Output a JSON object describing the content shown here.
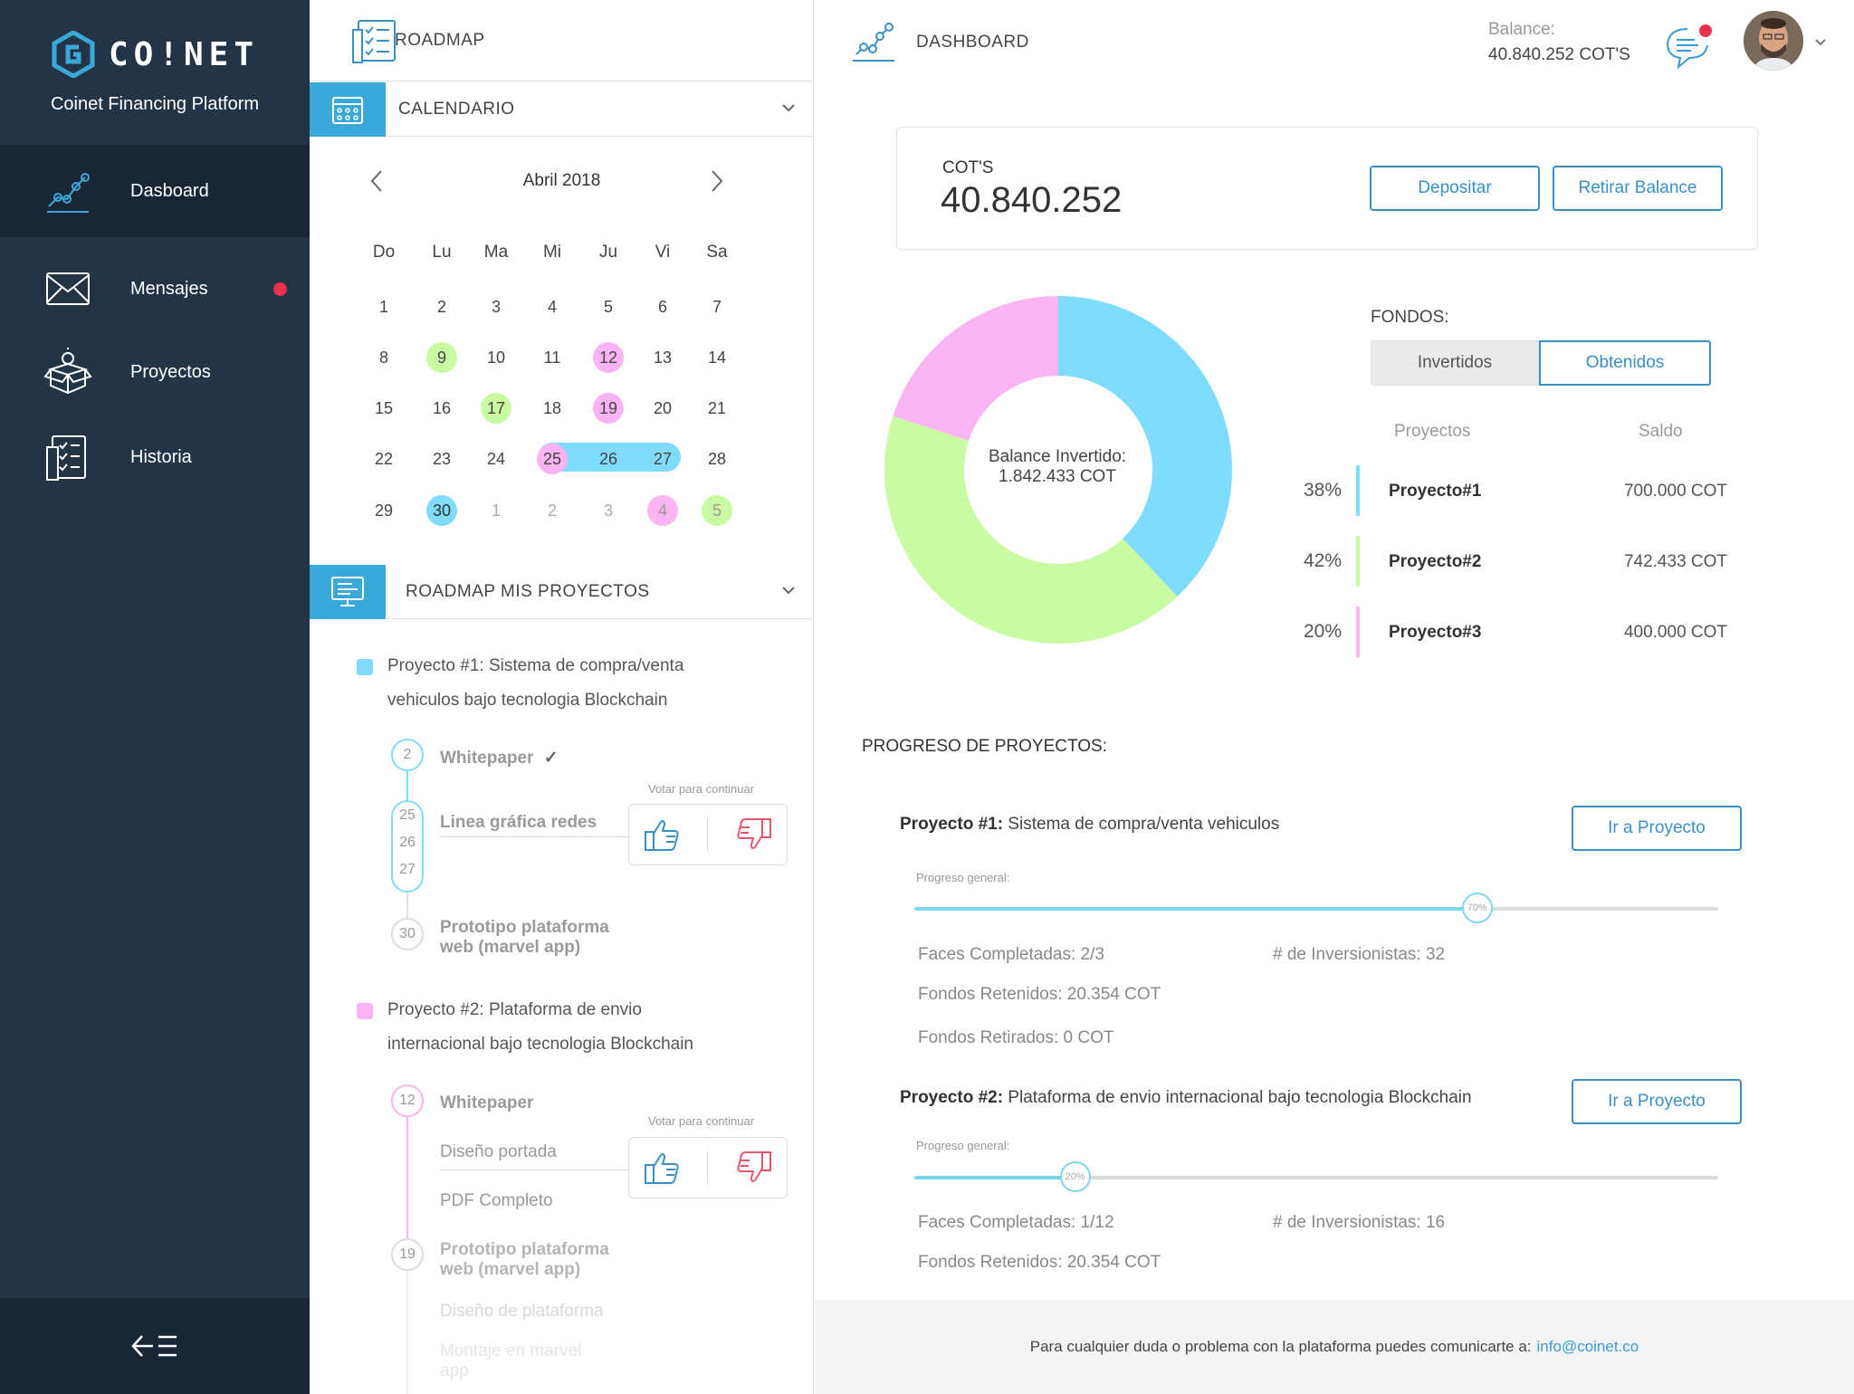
{
  "brand": {
    "name": "CO!NET",
    "subtitle": "Coinet Financing Platform"
  },
  "sidebar": {
    "items": [
      {
        "label": "Dasboard",
        "icon": "chart-steps-icon",
        "active": true
      },
      {
        "label": "Mensajes",
        "icon": "envelope-icon",
        "badge": true
      },
      {
        "label": "Proyectos",
        "icon": "box-bulb-icon"
      },
      {
        "label": "Historia",
        "icon": "checklist-icon"
      }
    ],
    "collapse_icon": "collapse-menu-icon"
  },
  "roadmap": {
    "title": "ROADMAP",
    "calendar_title": "CALENDARIO",
    "month": "Abril 2018",
    "weekdays": [
      "Do",
      "Lu",
      "Ma",
      "Mi",
      "Ju",
      "Vi",
      "Sa"
    ],
    "weeks": [
      [
        "1",
        "2",
        "3",
        "4",
        "5",
        "6",
        "7"
      ],
      [
        "8",
        "9",
        "10",
        "11",
        "12",
        "13",
        "14"
      ],
      [
        "15",
        "16",
        "17",
        "18",
        "19",
        "20",
        "21"
      ],
      [
        "22",
        "23",
        "24",
        "25",
        "26",
        "27",
        "28"
      ],
      [
        "29",
        "30",
        "1",
        "2",
        "3",
        "4",
        "5"
      ]
    ],
    "highlights": {
      "green": [
        "9",
        "17"
      ],
      "pink": [
        "12",
        "19",
        "25"
      ],
      "blue_today": [
        "30"
      ],
      "next_month_pink": [
        "4"
      ],
      "next_month_green": [
        "5"
      ],
      "range": [
        "25",
        "26",
        "27"
      ]
    },
    "projects_title": "ROADMAP MIS PROYECTOS",
    "vote_caption": "Votar para continuar",
    "projects": [
      {
        "title_line1": "Proyecto #1: Sistema de compra/venta",
        "title_line2": "vehiculos bajo tecnologia Blockchain",
        "color": "#7dd6ef",
        "steps": [
          {
            "day": "2",
            "label": "Whitepaper",
            "check": "✓"
          },
          {
            "days": [
              "25",
              "26",
              "27"
            ],
            "label": "Linea gráfica redes"
          },
          {
            "day": "30",
            "label_line1": "Prototipo plataforma",
            "label_line2": "web (marvel app)"
          }
        ]
      },
      {
        "title_line1": "Proyecto #2: Plataforma de envio",
        "title_line2": "internacional bajo tecnologia Blockchain",
        "color": "#f7a8f0",
        "steps": [
          {
            "day": "12",
            "label": "Whitepaper"
          },
          {
            "label": "Diseño portada"
          },
          {
            "label": "PDF Completo"
          },
          {
            "day": "19",
            "label_line1": "Prototipo plataforma",
            "label_line2": "web (marvel app)"
          },
          {
            "label": "Diseño de plataforma"
          },
          {
            "label_line1": "Montaje en marvel",
            "label_line2": "app"
          }
        ]
      }
    ]
  },
  "header": {
    "title": "DASHBOARD",
    "balance_label": "Balance:",
    "balance_value": "40.840.252  COT'S"
  },
  "balance_card": {
    "label": "COT'S",
    "value": "40.840.252",
    "deposit_label": "Depositar",
    "withdraw_label": "Retirar Balance"
  },
  "chart_data": {
    "type": "pie",
    "donut": true,
    "center_label_line1": "Balance Invertido:",
    "center_label_line2": "1.842.433 COT",
    "series": [
      {
        "name": "Proyecto#1",
        "value": 38,
        "color": "#7fdcfd"
      },
      {
        "name": "Proyecto#2",
        "value": 42,
        "color": "#c9fba3"
      },
      {
        "name": "Proyecto#3",
        "value": 20,
        "color": "#fbb4f3"
      }
    ]
  },
  "funds": {
    "label": "FONDOS:",
    "toggle_invested": "Invertidos",
    "toggle_obtained": "Obtenidos",
    "col_projects": "Proyectos",
    "col_balance": "Saldo",
    "rows": [
      {
        "pct": "38%",
        "name": "Proyecto#1",
        "saldo": "700.000 COT",
        "color": "#7fdcfd"
      },
      {
        "pct": "42%",
        "name": "Proyecto#2",
        "saldo": "742.433 COT",
        "color": "#c9fba3"
      },
      {
        "pct": "20%",
        "name": "Proyecto#3",
        "saldo": "400.000 COT",
        "color": "#fbb4f3"
      }
    ]
  },
  "progress": {
    "title": "PROGRESO DE PROYECTOS:",
    "caption": "Progreso general:",
    "go_label": "Ir a Proyecto",
    "projects": [
      {
        "name_bold": "Proyecto #1:",
        "name_rest": " Sistema de compra/venta vehiculos",
        "progress": 70,
        "progress_label": "70%",
        "phases": "Faces Completadas: 2/3",
        "investors": "# de Inversionistas: 32",
        "retained": "Fondos Retenidos: 20.354 COT",
        "withdrawn": "Fondos Retirados: 0 COT"
      },
      {
        "name_bold": "Proyecto #2:",
        "name_rest": " Plataforma de envio internacional bajo tecnologia Blockchain",
        "progress": 20,
        "progress_label": "20%",
        "phases": "Faces Completadas: 1/12",
        "investors": "# de Inversionistas: 16",
        "retained": "Fondos Retenidos: 20.354 COT"
      }
    ]
  },
  "footer": {
    "text": "Para cualquier duda o problema con la plataforma puedes comunicarte a:",
    "email": "info@coinet.co"
  },
  "colors": {
    "sidebar_bg": "#243447",
    "accent": "#3a8fc7",
    "blue": "#7fdcfd",
    "green": "#c9fba3",
    "pink": "#fbb4f3",
    "badge": "#e8324d"
  }
}
